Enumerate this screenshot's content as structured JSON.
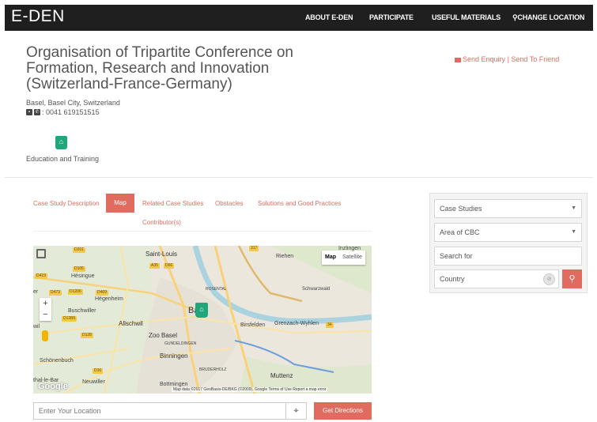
{
  "nav": {
    "brand": "E-DEN",
    "items": [
      "ABOUT E-DEN",
      "PARTICIPATE",
      "USEFUL MATERIALS",
      "CHANGE LOCATION"
    ]
  },
  "header": {
    "title": "Organisation of Tripartite Conference on Formation, Research and Innovation (Switzerland-France-Germany)",
    "address": "Basel, Basel City, Switzerland",
    "phone": ": 0041 619151515",
    "send_enquiry": "Send Enquiry",
    "separator": "|",
    "send_to_friend": "Send To Friend",
    "category": "Education and Training"
  },
  "tabs": {
    "case_study_description": "Case Study Description",
    "map": "Map",
    "related_case_studies": "Related Case Studies",
    "obstacles": "Obstacles",
    "solutions": "Solutions and Good Practices",
    "contributors": "Contributor(s)"
  },
  "map": {
    "type_map": "Map",
    "type_satellite": "Satellite",
    "zoom_in": "+",
    "zoom_out": "−",
    "places": {
      "saint_louis": "Saint-Louis",
      "riehen": "Riehen",
      "inzlingen": "Inzlingen",
      "hesingue": "Hésingue",
      "hegenheim": "Hégenheim",
      "buschwiller": "Buschwiller",
      "allschwil": "Allschwil",
      "basel_partial": "Ba",
      "zoo_basel": "Zoo Basel",
      "gundeldingen": "GUNDELDINGEN",
      "binningen": "Binningen",
      "bruderholz": "BRUDERHOLZ",
      "birsfelden": "Birsfelden",
      "grenzach": "Grenzach-Wyhlen",
      "muttenz": "Muttenz",
      "bottmingen": "Bottmingen",
      "neuwiller": "Neuwiller",
      "schonenbuch": "Schönenbuch",
      "rosental": "ROSENTAL",
      "schwarzwald": "Schwarzwald",
      "leb_bar": "thal-le-Bar",
      "er": "er",
      "wil": "wil"
    },
    "roads": [
      "D201",
      "A35",
      "D66",
      "317",
      "D105",
      "D419",
      "D473",
      "D1206",
      "D469",
      "D12B5",
      "D128",
      "D16",
      "34"
    ],
    "attribution": "Map data ©2017 GeoBasis-DE/BKG (©2009), Google   Terms of Use   Report a map error",
    "google": "Google"
  },
  "directions": {
    "placeholder": "Enter Your Location",
    "button": "Get Directions"
  },
  "sidebar": {
    "case_studies": "Case Studies",
    "area": "Area of CBC",
    "search_placeholder": "Search for",
    "country_placeholder": "Country"
  },
  "colors": {
    "accent": "#e06c5f",
    "navbar": "#1f1f1f",
    "category_green": "#1fa67a"
  }
}
